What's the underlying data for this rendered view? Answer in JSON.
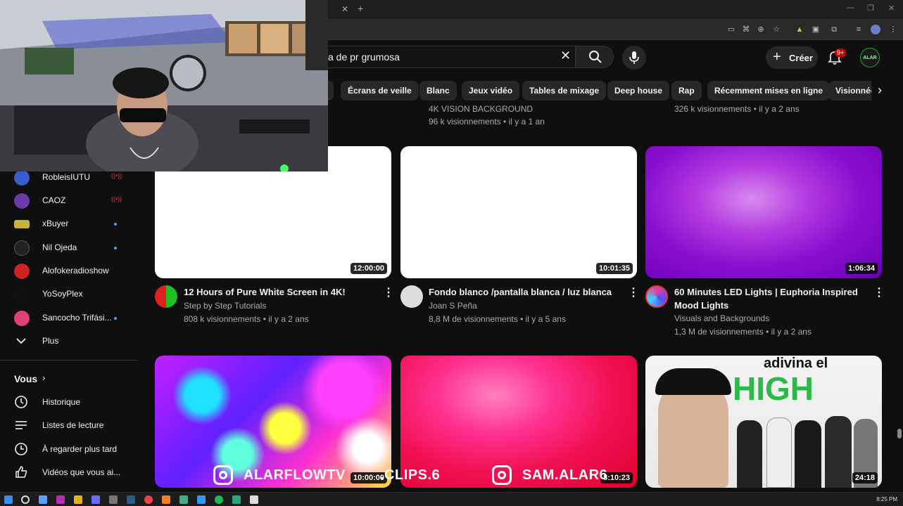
{
  "browser": {
    "minimize": "—",
    "restore": "❐",
    "close": "✕"
  },
  "header": {
    "search_value": "a de pr  grumosa",
    "create_label": "Créer",
    "notif_badge": "9+",
    "avatar_text": "ALAR"
  },
  "chips": [
    "Écrans de veille",
    "Blanc",
    "Jeux vidéo",
    "Tables de mixage",
    "Deep house",
    "Rap",
    "Récemment mises en ligne",
    "Visionnée"
  ],
  "sidebar": {
    "subscriptions": [
      {
        "label": "RobleisIUTU",
        "status": "live",
        "color": "#3a5ccc"
      },
      {
        "label": "CAOZ",
        "status": "live",
        "color": "#6a3aa8"
      },
      {
        "label": "xBuyer",
        "status": "new",
        "color": "#c9b13a"
      },
      {
        "label": "Nil Ojeda",
        "status": "new",
        "color": "#222222"
      },
      {
        "label": "Alofokeradioshow",
        "status": "none",
        "color": "#cc2222"
      },
      {
        "label": "YoSoyPlex",
        "status": "none",
        "color": "#111111"
      },
      {
        "label": "Sancocho Trifási...",
        "status": "new",
        "color": "#e0407a"
      }
    ],
    "more_label": "Plus",
    "you_label": "Vous",
    "you_items": [
      {
        "label": "Historique",
        "icon": "history-icon"
      },
      {
        "label": "Listes de lecture",
        "icon": "playlist-icon"
      },
      {
        "label": "À regarder plus tard",
        "icon": "clock-icon"
      },
      {
        "label": "Vidéos que vous ai...",
        "icon": "thumbs-up-icon"
      }
    ]
  },
  "top_partial": {
    "left_channel": "4K VISION BACKGROUND",
    "left_stats": "96 k visionnements • il y a 1 an",
    "right_stats": "326 k visionnements • il y a 2 ans"
  },
  "videos_row1": [
    {
      "title": "12 Hours of Pure White Screen in 4K!",
      "channel": "Step by Step Tutorials",
      "stats": "808 k visionnements • il y a 2 ans",
      "duration": "12:00:00"
    },
    {
      "title": "Fondo blanco /pantalla blanca / luz blanca",
      "channel": "Joan S Peña",
      "stats": "8,8 M de visionnements • il y a 5 ans",
      "duration": "10:01:35"
    },
    {
      "title": "60 Minutes LED Lights | Euphoria Inspired Mood Lights",
      "channel": "Visuals and Backgrounds",
      "stats": "1,3 M de visionnements • il y a 2 ans",
      "duration": "1:06:34"
    }
  ],
  "videos_row2": [
    {
      "duration": "10:00:00"
    },
    {
      "duration": "8:10:23"
    },
    {
      "duration": "24:18",
      "overlay_title_1": "adivina el",
      "overlay_title_2": "HIGH"
    }
  ],
  "watermarks": {
    "left": "ALARFLOWTV",
    "middle": ".CLIPS.6",
    "right": "SAM.ALAR6"
  },
  "taskbar": {
    "time": "8:25 PM"
  }
}
